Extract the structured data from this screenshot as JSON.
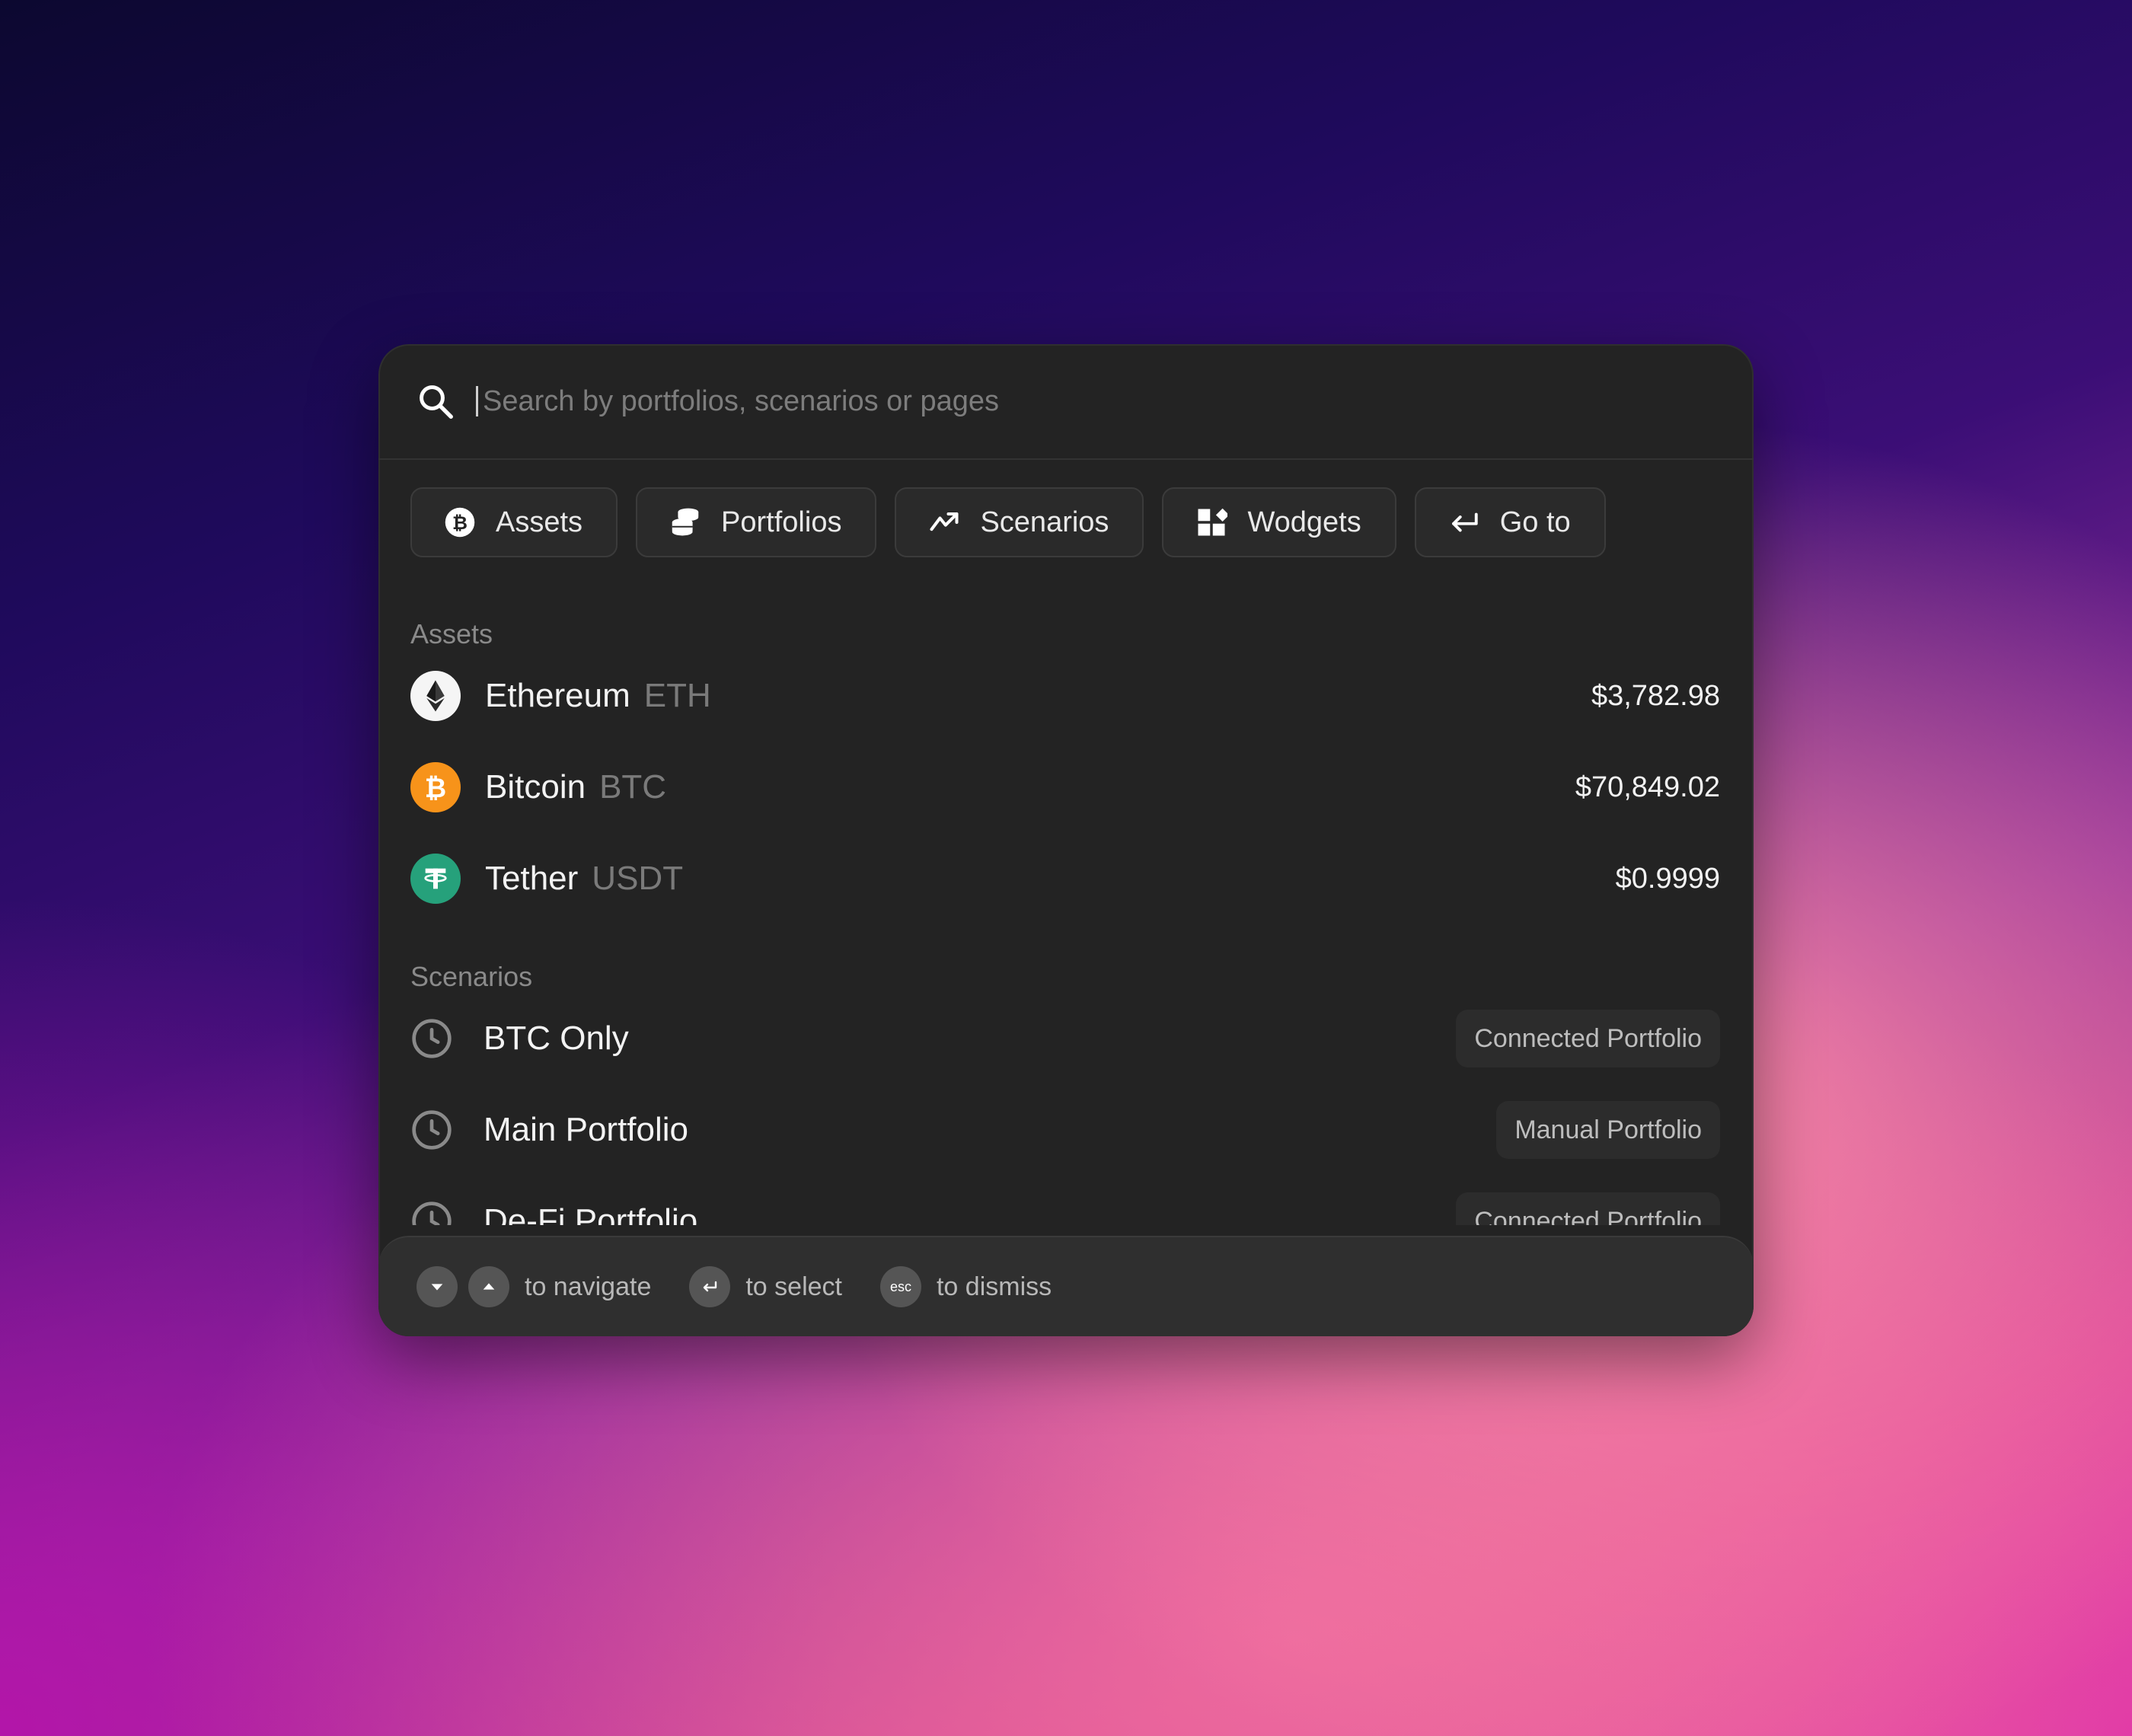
{
  "search": {
    "placeholder": "Search by portfolios, scenarios or pages",
    "value": ""
  },
  "filters": [
    {
      "label": "Assets",
      "icon": "bitcoin-icon"
    },
    {
      "label": "Portfolios",
      "icon": "coins-stack-icon"
    },
    {
      "label": "Scenarios",
      "icon": "trend-icon"
    },
    {
      "label": "Wodgets",
      "icon": "widgets-icon"
    },
    {
      "label": "Go to",
      "icon": "return-arrow-icon"
    }
  ],
  "assets": {
    "title": "Assets",
    "items": [
      {
        "name": "Ethereum",
        "ticker": "ETH",
        "price": "$3,782.98",
        "icon": "ethereum-icon",
        "color": "#f5f5f5"
      },
      {
        "name": "Bitcoin",
        "ticker": "BTC",
        "price": "$70,849.02",
        "icon": "bitcoin-icon",
        "color": "#f7931a"
      },
      {
        "name": "Tether",
        "ticker": "USDT",
        "price": "$0.9999",
        "icon": "tether-icon",
        "color": "#26a17b"
      }
    ]
  },
  "scenarios": {
    "title": "Scenarios",
    "items": [
      {
        "name": "BTC Only",
        "badge": "Connected Portfolio",
        "icon": "clock-icon"
      },
      {
        "name": "Main Portfolio",
        "badge": "Manual Portfolio",
        "icon": "clock-icon"
      },
      {
        "name": "De-Fi Portfolio",
        "badge": "Connected Portfolio",
        "icon": "clock-icon"
      }
    ]
  },
  "footer": {
    "navigate": "to navigate",
    "select": "to select",
    "esc_key": "esc",
    "dismiss": "to dismiss"
  }
}
